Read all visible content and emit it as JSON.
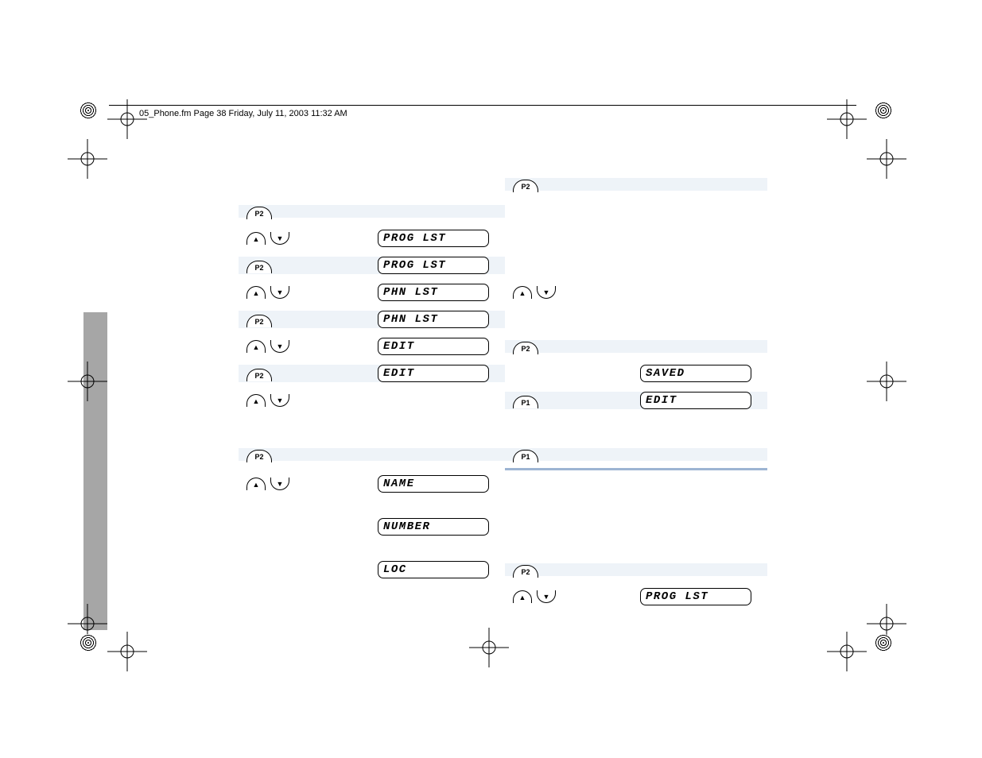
{
  "header": "05_Phone.fm  Page 38  Friday, July 11, 2003  11:32 AM",
  "btn": {
    "p1": "P1",
    "p2": "P2",
    "up": "▲",
    "down": "▼"
  },
  "lcd": {
    "prog_lst": "PROG  LST",
    "phn_lst": "PHN  LST",
    "edit": "EDIT",
    "name": "NAME",
    "number": "NUMBER",
    "loc": "LOC",
    "saved": "SAVED"
  }
}
